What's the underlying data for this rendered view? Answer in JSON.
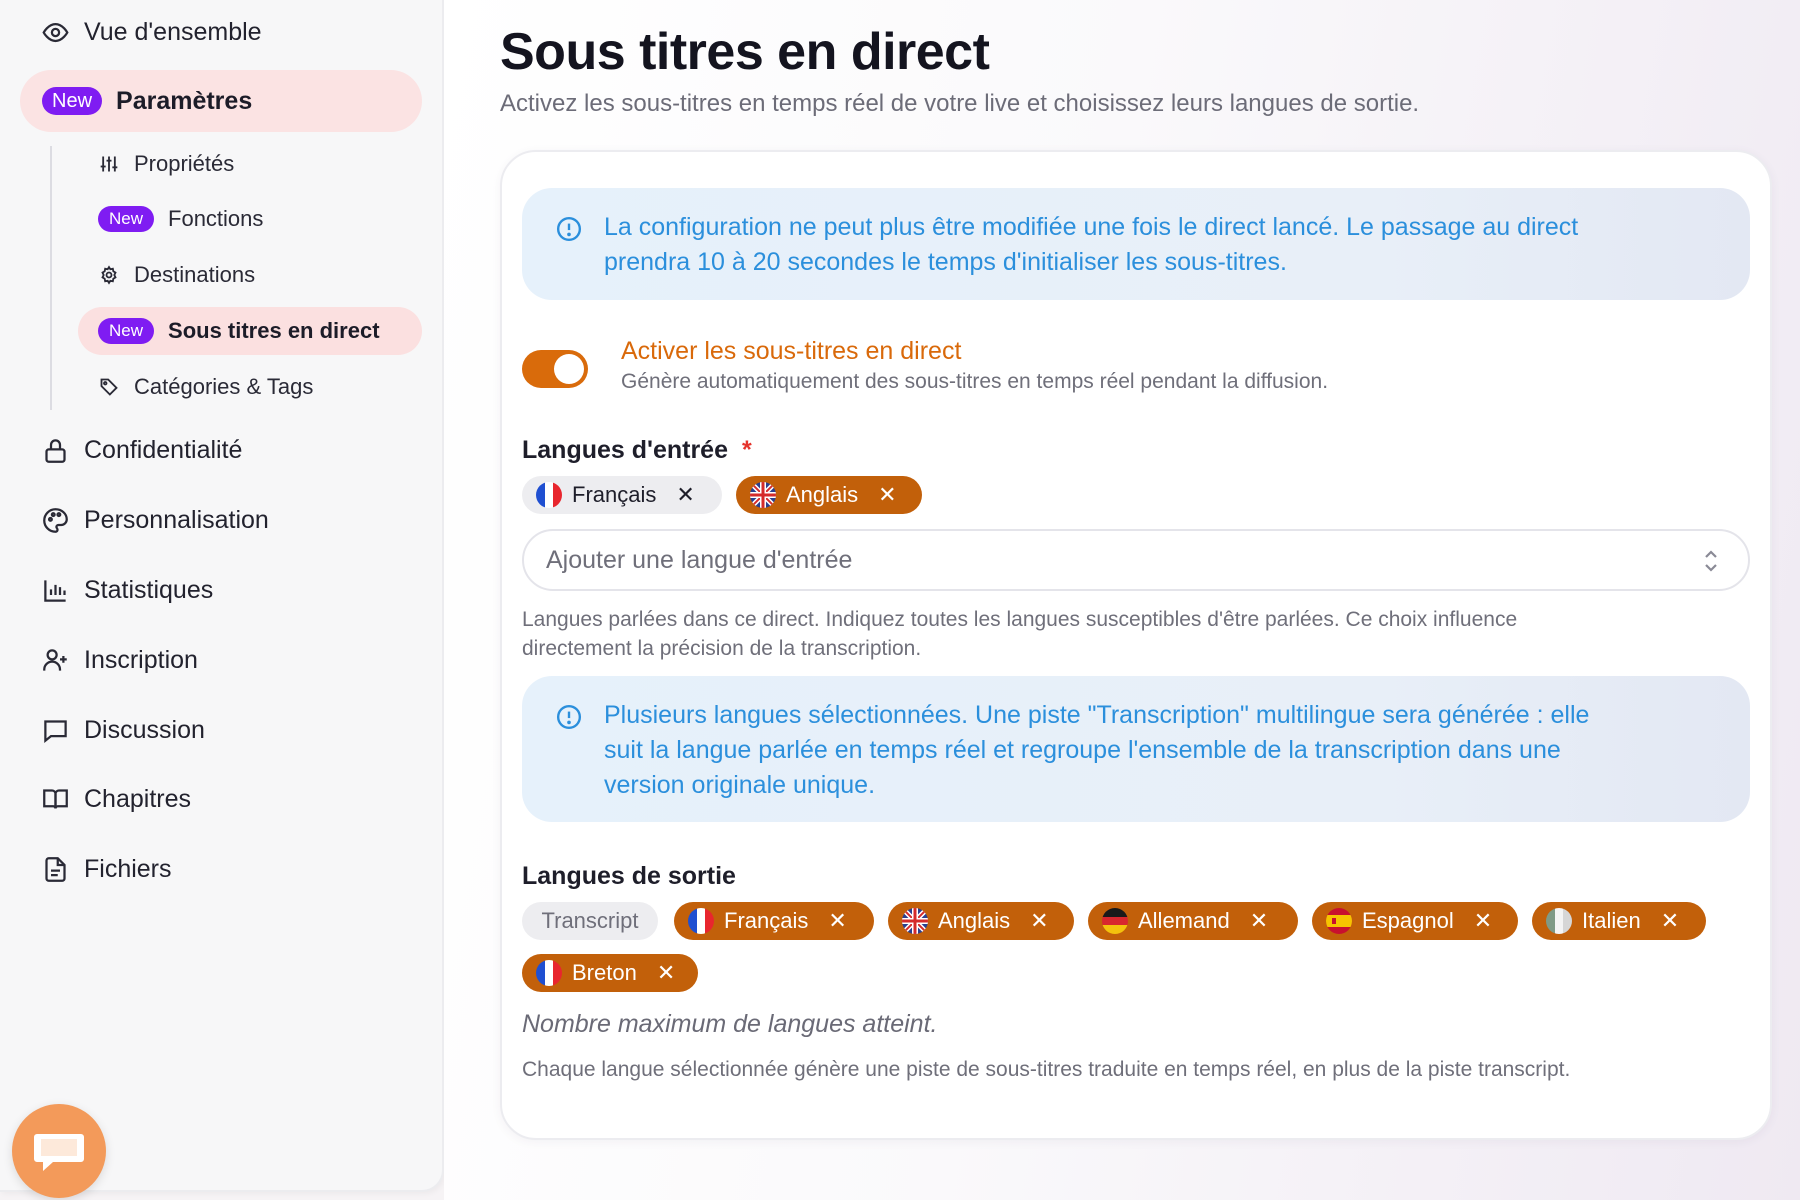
{
  "sidebar": {
    "overview": "Vue d'ensemble",
    "params_badge": "New",
    "params": "Paramètres",
    "sub": {
      "properties": "Propriétés",
      "functions_badge": "New",
      "functions": "Fonctions",
      "destinations": "Destinations",
      "live_subs_badge": "New",
      "live_subs": "Sous titres en direct",
      "categories": "Catégories & Tags"
    },
    "items": [
      {
        "label": "Confidentialité",
        "icon": "lock-icon"
      },
      {
        "label": "Personnalisation",
        "icon": "palette-icon"
      },
      {
        "label": "Statistiques",
        "icon": "bar-chart-icon"
      },
      {
        "label": "Inscription",
        "icon": "user-plus-icon"
      },
      {
        "label": "Discussion",
        "icon": "chat-icon"
      },
      {
        "label": "Chapitres",
        "icon": "book-icon"
      },
      {
        "label": "Fichiers",
        "icon": "file-icon"
      }
    ]
  },
  "header": {
    "title": "Sous titres en direct",
    "subtitle": "Activez les sous-titres en temps réel de votre live et choisissez leurs langues de sortie."
  },
  "alerts": {
    "config_line1": "La configuration ne peut plus être modifiée une fois le direct lancé. Le passage au direct",
    "config_line2": "prendra 10 à 20 secondes le temps d'initialiser les sous-titres.",
    "multi_line1": "Plusieurs langues sélectionnées. Une piste \"Transcription\" multilingue sera générée : elle",
    "multi_line2": "suit la langue parlée en temps réel et regroupe l'ensemble de la transcription dans une",
    "multi_line3": "version originale unique."
  },
  "toggle": {
    "enabled": true,
    "title": "Activer les sous-titres en direct",
    "description": "Génère automatiquement des sous-titres en temps réel pendant la diffusion."
  },
  "input_languages": {
    "title": "Langues d'entrée",
    "required_mark": "*",
    "chips": [
      {
        "label": "Français",
        "flag": "fr",
        "style": "grey"
      },
      {
        "label": "Anglais",
        "flag": "gb",
        "style": "orange"
      }
    ],
    "placeholder": "Ajouter une langue d'entrée",
    "help_line1": "Langues parlées dans ce direct. Indiquez toutes les langues susceptibles d'être parlées. Ce choix influence",
    "help_line2": "directement la précision de la transcription."
  },
  "output_languages": {
    "title": "Langues de sortie",
    "transcript": "Transcript",
    "chips": [
      {
        "label": "Français",
        "flag": "fr"
      },
      {
        "label": "Anglais",
        "flag": "gb"
      },
      {
        "label": "Allemand",
        "flag": "de"
      },
      {
        "label": "Espagnol",
        "flag": "es"
      },
      {
        "label": "Italien",
        "flag": "it"
      },
      {
        "label": "Breton",
        "flag": "fr"
      }
    ],
    "max_note": "Nombre maximum de langues atteint.",
    "help": "Chaque langue sélectionnée génère une piste de sous-titres traduite en temps réel, en plus de la piste transcript."
  },
  "colors": {
    "accent_orange": "#c2600a",
    "toggle_orange": "#d96b0b",
    "badge_purple": "#7f1cf2",
    "info_blue": "#2b8fdc"
  }
}
